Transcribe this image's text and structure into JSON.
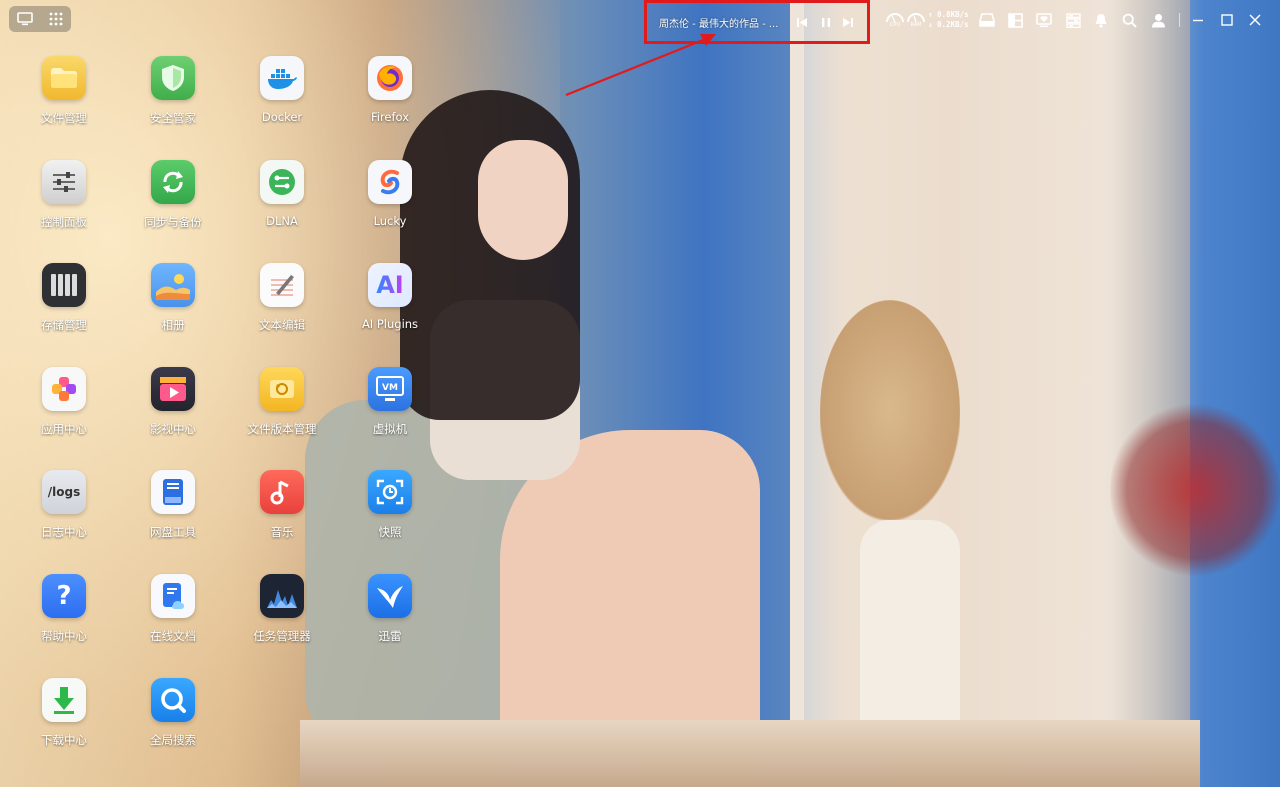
{
  "topbar": {
    "media": {
      "title": "周杰伦 - 最伟大的作品 - ...",
      "prev_icon": "skip-previous-icon",
      "pause_icon": "pause-icon",
      "next_icon": "skip-next-icon"
    },
    "cpu_label": "CPU",
    "ram_label": "RAM",
    "net_up": "↑ 0.8KB/s",
    "net_down": "↓ 0.2KB/s",
    "highlight_color": "#e11b1b"
  },
  "apps": [
    {
      "label": "文件管理",
      "icon": "folder-icon"
    },
    {
      "label": "安全管家",
      "icon": "shield-icon"
    },
    {
      "label": "Docker",
      "icon": "docker-icon"
    },
    {
      "label": "Firefox",
      "icon": "firefox-icon"
    },
    {
      "label": "控制面板",
      "icon": "sliders-icon"
    },
    {
      "label": "同步与备份",
      "icon": "sync-icon"
    },
    {
      "label": "DLNA",
      "icon": "dlna-icon"
    },
    {
      "label": "Lucky",
      "icon": "lucky-icon"
    },
    {
      "label": "存储管理",
      "icon": "storage-icon"
    },
    {
      "label": "相册",
      "icon": "photo-icon"
    },
    {
      "label": "文本编辑",
      "icon": "text-edit-icon"
    },
    {
      "label": "AI Plugins",
      "icon": "ai-icon",
      "icon_text": "AI"
    },
    {
      "label": "应用中心",
      "icon": "app-center-icon"
    },
    {
      "label": "影视中心",
      "icon": "video-icon"
    },
    {
      "label": "文件版本管理",
      "icon": "file-version-icon"
    },
    {
      "label": "虚拟机",
      "icon": "vm-icon",
      "icon_text": "VM"
    },
    {
      "label": "日志中心",
      "icon": "logs-icon",
      "icon_text": "/logs"
    },
    {
      "label": "网盘工具",
      "icon": "cloud-drive-icon"
    },
    {
      "label": "音乐",
      "icon": "music-icon"
    },
    {
      "label": "快照",
      "icon": "snapshot-icon"
    },
    {
      "label": "帮助中心",
      "icon": "help-icon",
      "icon_text": "?"
    },
    {
      "label": "在线文档",
      "icon": "online-doc-icon"
    },
    {
      "label": "任务管理器",
      "icon": "task-manager-icon"
    },
    {
      "label": "迅雷",
      "icon": "thunder-icon"
    },
    {
      "label": "下载中心",
      "icon": "download-icon"
    },
    {
      "label": "全局搜索",
      "icon": "global-search-icon"
    }
  ]
}
